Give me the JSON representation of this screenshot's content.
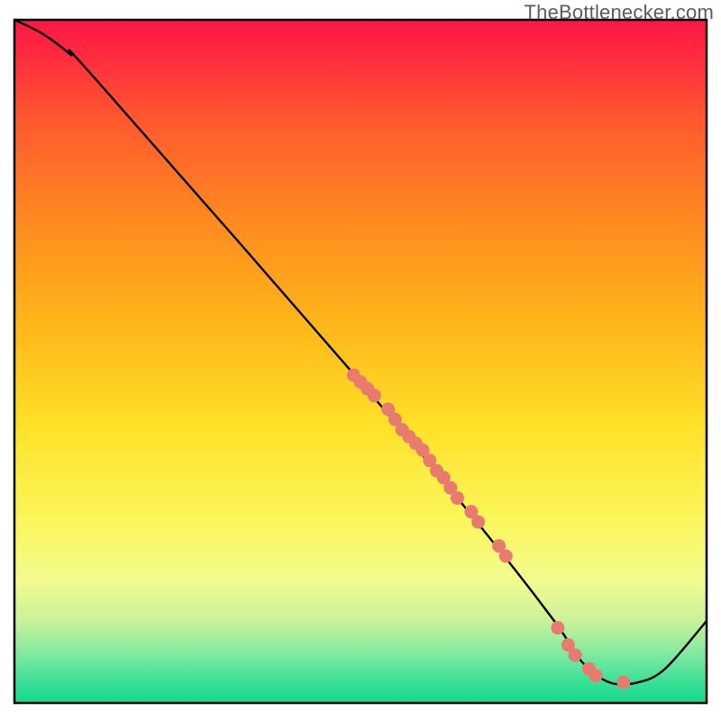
{
  "watermark": "TheBottlenecker.com",
  "chart_data": {
    "type": "line",
    "xlim": [
      0,
      100
    ],
    "ylim": [
      0,
      100
    ],
    "grid": false,
    "legend": false,
    "title": "",
    "xlabel": "",
    "ylabel": "",
    "note": "x is horizontal position in % of plot width, y is distance above bottom axis in % of plot height; this is a bottleneck-style curve with green bottom band and red top",
    "curve": [
      {
        "x": 0,
        "y": 100
      },
      {
        "x": 4,
        "y": 98
      },
      {
        "x": 8,
        "y": 95
      },
      {
        "x": 12,
        "y": 91
      },
      {
        "x": 50,
        "y": 47
      },
      {
        "x": 68,
        "y": 25
      },
      {
        "x": 78,
        "y": 12
      },
      {
        "x": 82,
        "y": 6
      },
      {
        "x": 86,
        "y": 3
      },
      {
        "x": 90,
        "y": 3
      },
      {
        "x": 94,
        "y": 5
      },
      {
        "x": 100,
        "y": 12
      }
    ],
    "scatter": [
      {
        "x": 49,
        "y": 48
      },
      {
        "x": 50,
        "y": 47
      },
      {
        "x": 51,
        "y": 46
      },
      {
        "x": 52,
        "y": 45
      },
      {
        "x": 54,
        "y": 43
      },
      {
        "x": 55,
        "y": 41.5
      },
      {
        "x": 56,
        "y": 40
      },
      {
        "x": 57,
        "y": 39
      },
      {
        "x": 58,
        "y": 38
      },
      {
        "x": 59,
        "y": 37
      },
      {
        "x": 60,
        "y": 35.5
      },
      {
        "x": 61,
        "y": 34
      },
      {
        "x": 62,
        "y": 33
      },
      {
        "x": 63,
        "y": 31.5
      },
      {
        "x": 64,
        "y": 30
      },
      {
        "x": 66,
        "y": 28
      },
      {
        "x": 67,
        "y": 26.5
      },
      {
        "x": 70,
        "y": 23
      },
      {
        "x": 71,
        "y": 21.5
      },
      {
        "x": 78.5,
        "y": 11
      },
      {
        "x": 80,
        "y": 8.5
      },
      {
        "x": 81,
        "y": 7
      },
      {
        "x": 83,
        "y": 5
      },
      {
        "x": 84,
        "y": 4
      },
      {
        "x": 88,
        "y": 3
      }
    ],
    "scatter_color": "#e97a6e",
    "line_color": "#000000",
    "gradient_stops": [
      {
        "offset": 0.0,
        "color": "#ff1744"
      },
      {
        "offset": 0.05,
        "color": "#ff2a3f"
      },
      {
        "offset": 0.15,
        "color": "#ff5a2e"
      },
      {
        "offset": 0.3,
        "color": "#ff8c1f"
      },
      {
        "offset": 0.45,
        "color": "#ffb81a"
      },
      {
        "offset": 0.6,
        "color": "#ffe22a"
      },
      {
        "offset": 0.73,
        "color": "#fbf65a"
      },
      {
        "offset": 0.82,
        "color": "#f3fb8e"
      },
      {
        "offset": 0.88,
        "color": "#c9f29a"
      },
      {
        "offset": 0.93,
        "color": "#7de9a1"
      },
      {
        "offset": 0.975,
        "color": "#2fdf94"
      },
      {
        "offset": 1.0,
        "color": "#18d98e"
      }
    ]
  }
}
